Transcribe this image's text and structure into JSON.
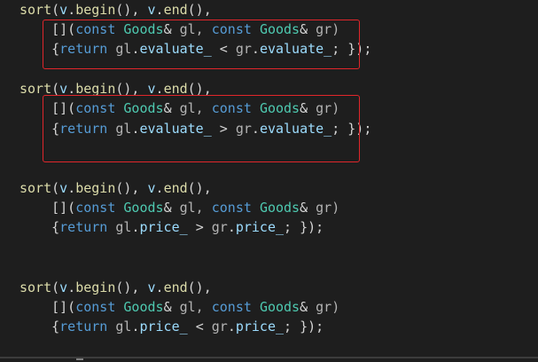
{
  "code_blocks": [
    {
      "sort_call": {
        "fn": "sort",
        "p1": "(",
        "v1": "v",
        "d1": ".",
        "m1": "begin",
        "p2": "(),",
        "v2": "v",
        "d2": ".",
        "m2": "end",
        "p3": "(),"
      },
      "lambda_head": {
        "brackets": "[](",
        "kw1": "const",
        "type1": "Goods",
        "amp1": "&",
        "p1": "gl,",
        "kw2": "const",
        "type2": "Goods",
        "amp2": "&",
        "p2": "gr)"
      },
      "lambda_body": {
        "open": "{",
        "kw": "return",
        "lhs": "gl",
        "dot1": ".",
        "field1": "evaluate_",
        "op": "<",
        "rhs": "gr",
        "dot2": ".",
        "field2": "evaluate_",
        "close": "; });"
      }
    },
    {
      "sort_call": {
        "fn": "sort",
        "p1": "(",
        "v1": "v",
        "d1": ".",
        "m1": "begin",
        "p2": "(),",
        "v2": "v",
        "d2": ".",
        "m2": "end",
        "p3": "(),"
      },
      "lambda_head": {
        "brackets": "[](",
        "kw1": "const",
        "type1": "Goods",
        "amp1": "&",
        "p1": "gl,",
        "kw2": "const",
        "type2": "Goods",
        "amp2": "&",
        "p2": "gr)"
      },
      "lambda_body": {
        "open": "{",
        "kw": "return",
        "lhs": "gl",
        "dot1": ".",
        "field1": "evaluate_",
        "op": ">",
        "rhs": "gr",
        "dot2": ".",
        "field2": "evaluate_",
        "close": "; });"
      }
    },
    {
      "sort_call": {
        "fn": "sort",
        "p1": "(",
        "v1": "v",
        "d1": ".",
        "m1": "begin",
        "p2": "(),",
        "v2": "v",
        "d2": ".",
        "m2": "end",
        "p3": "(),"
      },
      "lambda_head": {
        "brackets": "[](",
        "kw1": "const",
        "type1": "Goods",
        "amp1": "&",
        "p1": "gl,",
        "kw2": "const",
        "type2": "Goods",
        "amp2": "&",
        "p2": "gr)"
      },
      "lambda_body": {
        "open": "{",
        "kw": "return",
        "lhs": "gl",
        "dot1": ".",
        "field1": "price_",
        "op": ">",
        "rhs": "gr",
        "dot2": ".",
        "field2": "price_",
        "close": "; });"
      }
    },
    {
      "sort_call": {
        "fn": "sort",
        "p1": "(",
        "v1": "v",
        "d1": ".",
        "m1": "begin",
        "p2": "(),",
        "v2": "v",
        "d2": ".",
        "m2": "end",
        "p3": "(),"
      },
      "lambda_head": {
        "brackets": "[](",
        "kw1": "const",
        "type1": "Goods",
        "amp1": "&",
        "p1": "gl,",
        "kw2": "const",
        "type2": "Goods",
        "amp2": "&",
        "p2": "gr)"
      },
      "lambda_body": {
        "open": "{",
        "kw": "return",
        "lhs": "gl",
        "dot1": ".",
        "field1": "price_",
        "op": "<",
        "rhs": "gr",
        "dot2": ".",
        "field2": "price_",
        "close": "; });"
      }
    }
  ],
  "colors": {
    "background": "#1e1e1e",
    "function": "#dcdcaa",
    "keyword": "#569cd6",
    "type": "#4ec9b0",
    "identifier": "#9cdcfe",
    "highlight_box": "#e0262b"
  }
}
